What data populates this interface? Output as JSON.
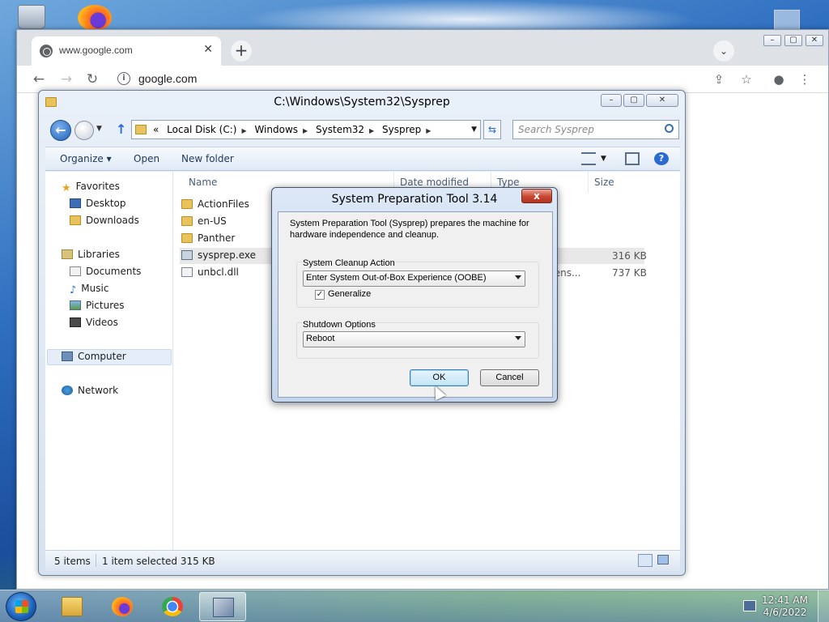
{
  "chrome": {
    "tab_title": "www.google.com",
    "tab_close": "✕",
    "newtab": "+",
    "tabsearch": "⌄",
    "url": "google.com",
    "win_min": "–",
    "win_max": "▢",
    "win_close": "✕"
  },
  "explorer": {
    "title": "C:\\Windows\\System32\\Sysprep",
    "address": {
      "chevrons": "«",
      "crumbs": [
        "Local Disk (C:)",
        "Windows",
        "System32",
        "Sysprep"
      ]
    },
    "search_placeholder": "Search Sysprep",
    "commands": {
      "organize": "Organize ▾",
      "open": "Open",
      "new_folder": "New folder"
    },
    "nav": {
      "favorites": "Favorites",
      "desktop": "Desktop",
      "downloads": "Downloads",
      "libraries": "Libraries",
      "documents": "Documents",
      "music": "Music",
      "pictures": "Pictures",
      "videos": "Videos",
      "computer": "Computer",
      "network": "Network"
    },
    "columns": {
      "name": "Name",
      "date_modified": "Date modified",
      "type": "Type",
      "size": "Size"
    },
    "files": [
      {
        "name": "ActionFiles",
        "type_text": "",
        "size": ""
      },
      {
        "name": "en-US",
        "type_text": "",
        "size": ""
      },
      {
        "name": "Panther",
        "type_text": "",
        "size": ""
      },
      {
        "name": "sysprep.exe",
        "type_text": "",
        "size": "316 KB"
      },
      {
        "name": "unbcl.dll",
        "type_text": "tens...",
        "size": "737 KB"
      }
    ],
    "status": {
      "items": "5 items",
      "selected": "1 item selected  315 KB"
    }
  },
  "dialog": {
    "title": "System Preparation Tool 3.14",
    "close": "x",
    "description": "System Preparation Tool (Sysprep) prepares the machine for hardware independence and cleanup.",
    "cleanup_label": "System Cleanup Action",
    "cleanup_value": "Enter System Out-of-Box Experience (OOBE)",
    "generalize_checked": "✓",
    "generalize_label": "Generalize",
    "shutdown_label": "Shutdown Options",
    "shutdown_value": "Reboot",
    "ok": "OK",
    "cancel": "Cancel"
  },
  "taskbar": {
    "time": "12:41 AM",
    "date": "4/6/2022"
  }
}
